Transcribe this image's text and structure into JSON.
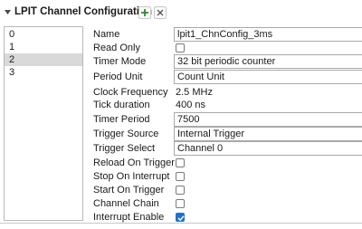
{
  "header": {
    "title": "LPIT Channel Configuration",
    "add_icon": "plus-icon",
    "remove_icon": "close-icon",
    "collapse_icon": "triangle-down-icon"
  },
  "channels": {
    "items": [
      "0",
      "1",
      "2",
      "3"
    ],
    "selected": "2"
  },
  "properties": {
    "name": {
      "label": "Name",
      "value": "lpit1_ChnConfig_3ms"
    },
    "read_only": {
      "label": "Read Only",
      "checked": false
    },
    "timer_mode": {
      "label": "Timer Mode",
      "value": "32 bit periodic counter"
    },
    "period_unit": {
      "label": "Period Unit",
      "value": "Count Unit"
    },
    "clock_frequency": {
      "label": "Clock Frequency",
      "value": "2.5 MHz"
    },
    "tick_duration": {
      "label": "Tick duration",
      "value": "400 ns"
    },
    "timer_period": {
      "label": "Timer Period",
      "value": "7500"
    },
    "trigger_source": {
      "label": "Trigger Source",
      "value": "Internal Trigger"
    },
    "trigger_select": {
      "label": "Trigger Select",
      "value": "Channel 0"
    },
    "reload_on_trigger": {
      "label": "Reload On Trigger",
      "checked": false
    },
    "stop_on_interrupt": {
      "label": "Stop On Interrupt",
      "checked": false
    },
    "start_on_trigger": {
      "label": "Start On Trigger",
      "checked": false
    },
    "channel_chain": {
      "label": "Channel Chain",
      "checked": false
    },
    "interrupt_enable": {
      "label": "Interrupt Enable",
      "checked": true
    }
  },
  "colors": {
    "accent": "#1f6fd1",
    "plus": "#2e8b2e",
    "selected_row": "#d9d9d9"
  }
}
